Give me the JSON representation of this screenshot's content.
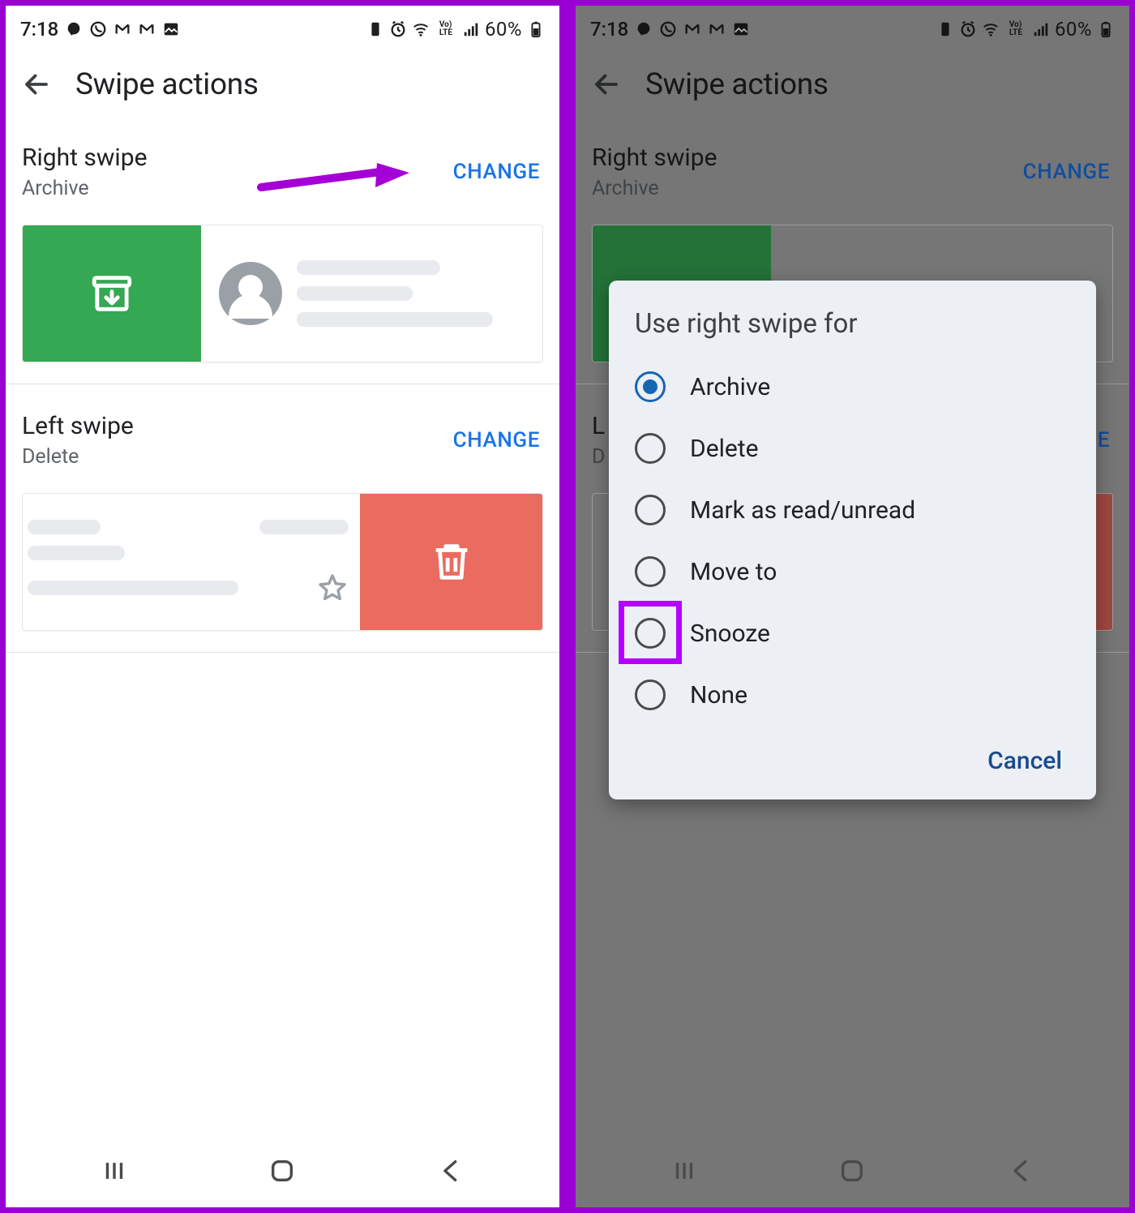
{
  "statusbar": {
    "time": "7:18",
    "battery": "60%"
  },
  "toolbar": {
    "title": "Swipe actions"
  },
  "right_swipe": {
    "title": "Right swipe",
    "action": "Archive",
    "change": "CHANGE"
  },
  "left_swipe": {
    "title": "Left swipe",
    "action": "Delete",
    "change": "CHANGE"
  },
  "dialog": {
    "title": "Use right swipe for",
    "options": [
      {
        "label": "Archive",
        "selected": true
      },
      {
        "label": "Delete",
        "selected": false
      },
      {
        "label": "Mark as read/unread",
        "selected": false
      },
      {
        "label": "Move to",
        "selected": false
      },
      {
        "label": "Snooze",
        "selected": false
      },
      {
        "label": "None",
        "selected": false
      }
    ],
    "highlighted_option_index": 4,
    "cancel": "Cancel"
  }
}
